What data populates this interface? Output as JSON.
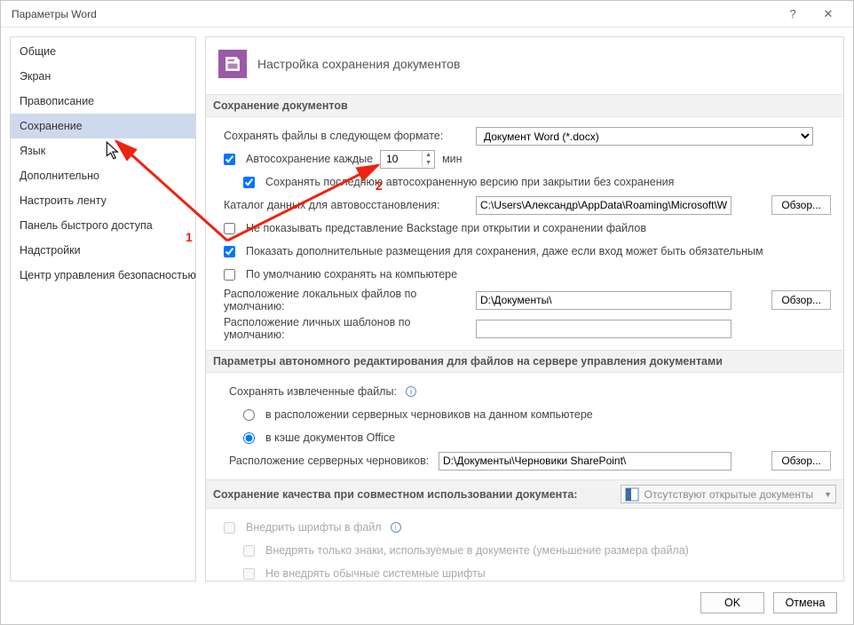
{
  "window": {
    "title": "Параметры Word"
  },
  "titlebar": {
    "help": "?",
    "close": "✕"
  },
  "sidebar": {
    "items": [
      {
        "label": "Общие"
      },
      {
        "label": "Экран"
      },
      {
        "label": "Правописание"
      },
      {
        "label": "Сохранение",
        "selected": true
      },
      {
        "label": "Язык"
      },
      {
        "label": "Дополнительно"
      },
      {
        "label": "Настроить ленту"
      },
      {
        "label": "Панель быстрого доступа"
      },
      {
        "label": "Надстройки"
      },
      {
        "label": "Центр управления безопасностью"
      }
    ]
  },
  "page": {
    "title": "Настройка сохранения документов"
  },
  "group1": {
    "title": "Сохранение документов",
    "save_format_label": "Сохранять файлы в следующем формате:",
    "save_format_value": "Документ Word (*.docx)",
    "autosave_label": "Автосохранение каждые",
    "autosave_value": "10",
    "autosave_unit": "мин",
    "keep_last_label": "Сохранять последнюю автосохраненную версию при закрытии без сохранения",
    "autorecover_path_label": "Каталог данных для автовосстановления:",
    "autorecover_path": "C:\\Users\\Александр\\AppData\\Roaming\\Microsoft\\W",
    "browse": "Обзор...",
    "no_backstage_label": "Не показывать представление Backstage при открытии и сохранении файлов",
    "show_additional_label": "Показать дополнительные размещения для сохранения, даже если вход может быть обязательным",
    "default_pc_label": "По умолчанию сохранять на компьютере",
    "local_files_label": "Расположение локальных файлов по умолчанию:",
    "local_files_path": "D:\\Документы\\",
    "personal_templates_label": "Расположение личных шаблонов по умолчанию:",
    "personal_templates_path": ""
  },
  "group2": {
    "title": "Параметры автономного редактирования для файлов на сервере управления документами",
    "save_checkedout_label": "Сохранять извлеченные файлы:",
    "radio1": "в расположении серверных черновиков на данном компьютере",
    "radio2": "в кэше документов Office",
    "drafts_label": "Расположение серверных черновиков:",
    "drafts_path": "D:\\Документы\\Черновики SharePoint\\",
    "browse": "Обзор..."
  },
  "group3": {
    "title": "Сохранение качества при совместном использовании документа:",
    "doc_status": "Отсутствуют открытые документы",
    "embed_fonts": "Внедрить шрифты в файл",
    "embed_used": "Внедрять только знаки, используемые в документе (уменьшение размера файла)",
    "no_system": "Не внедрять обычные системные шрифты"
  },
  "footer": {
    "ok": "OK",
    "cancel": "Отмена"
  },
  "annotations": {
    "n1": "1",
    "n2": "2"
  }
}
